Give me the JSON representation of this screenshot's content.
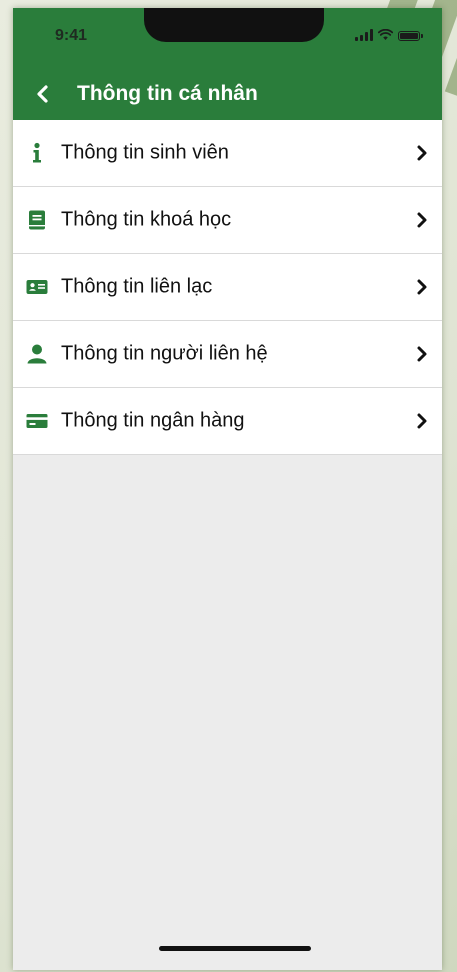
{
  "status_bar": {
    "time": "9:41"
  },
  "header": {
    "title": "Thông tin cá nhân",
    "back_icon": "chevron-left-icon"
  },
  "menu": {
    "items": [
      {
        "label": "Thông tin sinh viên",
        "icon": "info-icon"
      },
      {
        "label": "Thông tin khoá học",
        "icon": "book-icon"
      },
      {
        "label": "Thông tin liên lạc",
        "icon": "id-card-icon"
      },
      {
        "label": "Thông tin người liên hệ",
        "icon": "person-icon"
      },
      {
        "label": "Thông tin ngân hàng",
        "icon": "credit-card-icon"
      }
    ]
  },
  "colors": {
    "brand_green": "#2a7d3b",
    "background": "#ececec"
  }
}
